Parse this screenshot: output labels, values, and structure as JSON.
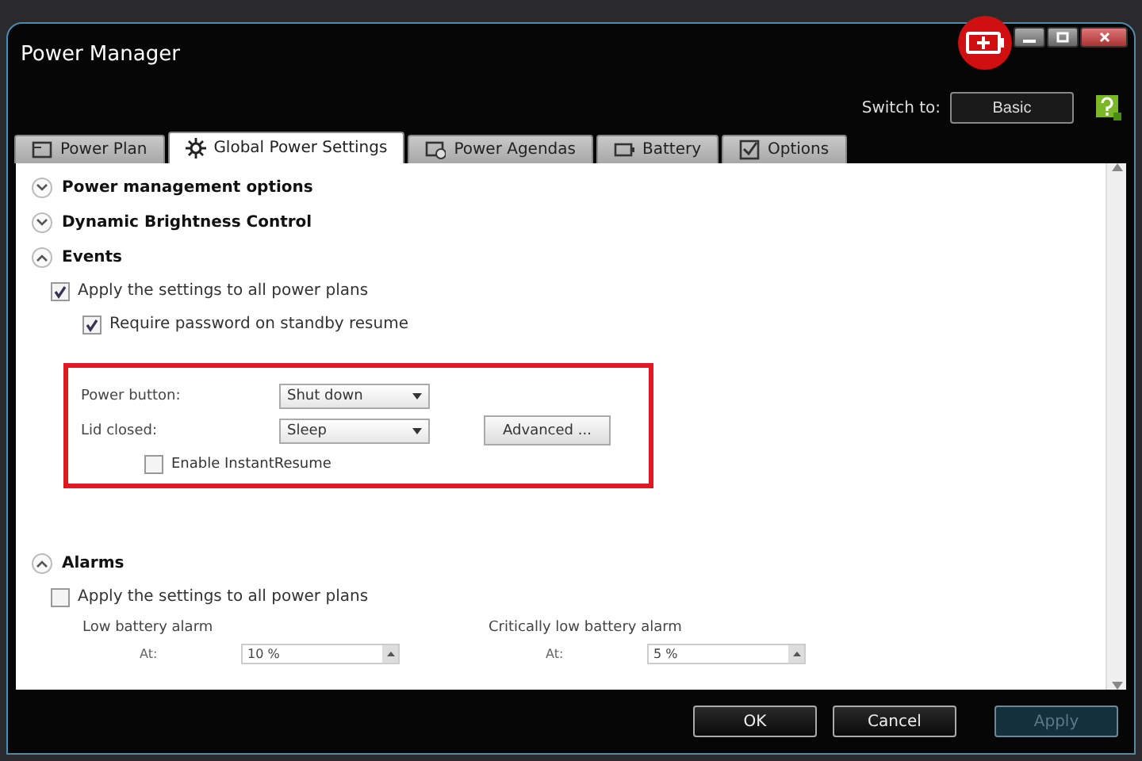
{
  "window": {
    "title": "Power Manager"
  },
  "switch_to": {
    "label": "Switch to:",
    "button": "Basic"
  },
  "tabs": [
    {
      "label": "Power Plan",
      "kind": "plan",
      "selected": false
    },
    {
      "label": "Global Power Settings",
      "kind": "gear",
      "selected": true
    },
    {
      "label": "Power Agendas",
      "kind": "agenda",
      "selected": false
    },
    {
      "label": "Battery",
      "kind": "battery",
      "selected": false
    },
    {
      "label": "Options",
      "kind": "check",
      "selected": false
    }
  ],
  "sections": [
    {
      "title": "Power management options",
      "expanded": false
    },
    {
      "title": "Dynamic Brightness Control",
      "expanded": false
    },
    {
      "title": "Events",
      "expanded": true
    },
    {
      "title": "Alarms",
      "expanded": true
    }
  ],
  "events": {
    "apply_all": {
      "label": "Apply the settings to all power plans",
      "checked": true
    },
    "require_password": {
      "label": "Require password on standby resume",
      "checked": true
    },
    "power_button": {
      "label": "Power button:",
      "value": "Shut down"
    },
    "lid_closed": {
      "label": "Lid closed:",
      "value": "Sleep"
    },
    "advanced_button": "Advanced ...",
    "instant_resume": {
      "label": "Enable InstantResume",
      "checked": false
    }
  },
  "alarms": {
    "apply_all": {
      "label": "Apply the settings to all power plans",
      "checked": false
    },
    "low": {
      "title": "Low battery alarm",
      "label": "At:",
      "value": "10 %"
    },
    "critical": {
      "title": "Critically low battery alarm",
      "label": "At:",
      "value": "5 %"
    }
  },
  "buttons": [
    {
      "label": "OK",
      "disabled": false
    },
    {
      "label": "Cancel",
      "disabled": false
    },
    {
      "label": "Apply",
      "disabled": true
    }
  ]
}
